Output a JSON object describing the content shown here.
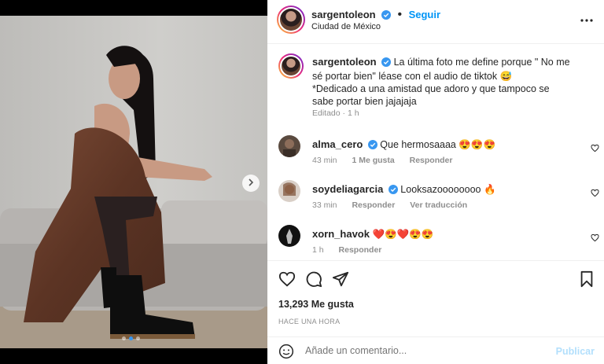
{
  "post": {
    "username": "sargentoleon",
    "follow_label": "Seguir",
    "location": "Ciudad de México",
    "caption_username": "sargentoleon",
    "caption_text": "La última foto me define porque \" No me sé portar bien\" léase con el audio de tiktok 😅",
    "caption_text_2": "*Dedicado a una amistad que adoro y que tampoco se sabe portar bien jajajaja",
    "caption_meta": "Editado · 1 h"
  },
  "comments": [
    {
      "username": "alma_cero",
      "verified": true,
      "text": "Que hermosaaaa 😍😍😍",
      "time": "43 min",
      "likes": "1 Me gusta",
      "reply": "Responder",
      "translate": ""
    },
    {
      "username": "soydeliagarcia",
      "verified": true,
      "text": "Looksazoooooooo 🔥",
      "time": "33 min",
      "likes": "",
      "reply": "Responder",
      "translate": "Ver traducción"
    },
    {
      "username": "xorn_havok",
      "verified": false,
      "text": "❤️😍❤️😍😍",
      "time": "1 h",
      "likes": "",
      "reply": "Responder",
      "translate": ""
    }
  ],
  "footer": {
    "likes": "13,293 Me gusta",
    "time_ago": "HACE UNA HORA",
    "comment_placeholder": "Añade un comentario...",
    "publish_label": "Publicar"
  },
  "icons": {
    "verified": "verified-badge-icon",
    "more": "more-options-icon",
    "like": "heart-icon",
    "comment": "comment-icon",
    "share": "share-icon",
    "save": "bookmark-icon",
    "emoji": "emoji-icon",
    "next": "chevron-right-icon"
  },
  "colors": {
    "accent": "#0095f6",
    "verified": "#3897f0",
    "muted": "#8e8e8e"
  }
}
